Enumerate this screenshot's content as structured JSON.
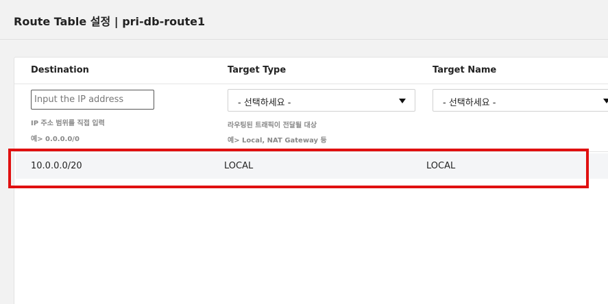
{
  "header": {
    "title": "Route Table 설정 | pri-db-route1"
  },
  "columns": {
    "destination": "Destination",
    "target_type": "Target Type",
    "target_name": "Target Name"
  },
  "form": {
    "ip_placeholder": "Input the IP address",
    "ip_value": "",
    "destination_hint_1": "IP 주소 범위를 직접 입력",
    "destination_hint_2": "예> 0.0.0.0/0",
    "target_type_selected": "- 선택하세요 -",
    "target_type_hint_1": "라우팅된 트래픽이 전달될 대상",
    "target_type_hint_2": "예> Local, NAT Gateway 등",
    "target_name_selected": "- 선택하세요 -"
  },
  "routes": [
    {
      "destination": "10.0.0.0/20",
      "target_type": "LOCAL",
      "target_name": "LOCAL"
    }
  ],
  "colors": {
    "highlight": "#e01010",
    "row_background": "#f4f5f7"
  },
  "icons": {
    "dropdown": "caret-down-icon"
  }
}
